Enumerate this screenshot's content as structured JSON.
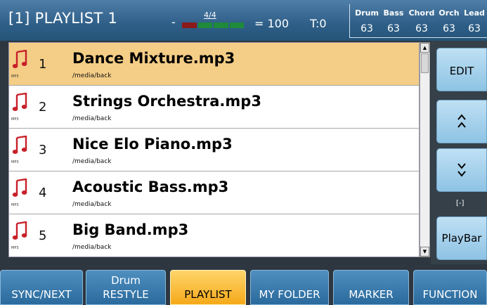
{
  "header": {
    "title": "[1] PLAYLIST 1",
    "dash": "-",
    "time_signature": "4/4",
    "beat_colors": [
      "#8b1a1a",
      "#1f8a3a",
      "#1f8a3a",
      "#1f8a3a"
    ],
    "tempo": "= 100",
    "transpose": "T:0",
    "volumes": [
      {
        "name": "Drum",
        "value": "63"
      },
      {
        "name": "Bass",
        "value": "63"
      },
      {
        "name": "Chord",
        "value": "63"
      },
      {
        "name": "Orch",
        "value": "63"
      },
      {
        "name": "Lead",
        "value": "63"
      }
    ]
  },
  "playlist": {
    "icon_label": "MP3",
    "items": [
      {
        "number": "1",
        "name": "Dance Mixture.mp3",
        "path": "/media/back",
        "selected": true
      },
      {
        "number": "2",
        "name": "Strings Orchestra.mp3",
        "path": "/media/back",
        "selected": false
      },
      {
        "number": "3",
        "name": "Nice Elo Piano.mp3",
        "path": "/media/back",
        "selected": false
      },
      {
        "number": "4",
        "name": "Acoustic Bass.mp3",
        "path": "/media/back",
        "selected": false
      },
      {
        "number": "5",
        "name": "Big Band.mp3",
        "path": "/media/back",
        "selected": false
      }
    ]
  },
  "right_panel": {
    "edit_label": "EDIT",
    "up_label": "^^",
    "down_label": "vv",
    "indicator": "[-]",
    "playbar_label": "PlayBar"
  },
  "bottom_tabs": [
    {
      "line1": "SYNC/NEXT",
      "line2": "",
      "active": false
    },
    {
      "line1": "Drum",
      "line2": "RESTYLE",
      "active": false
    },
    {
      "line1": "PLAYLIST",
      "line2": "",
      "active": true
    },
    {
      "line1": "MY FOLDER",
      "line2": "",
      "active": false
    },
    {
      "line1": "MARKER",
      "line2": "",
      "active": false
    },
    {
      "line1": "FUNCTION",
      "line2": "",
      "active": false
    }
  ],
  "colors": {
    "selected_row": "#f4cd86",
    "active_tab": "#f5a91a",
    "note_icon": "#c8202a"
  }
}
